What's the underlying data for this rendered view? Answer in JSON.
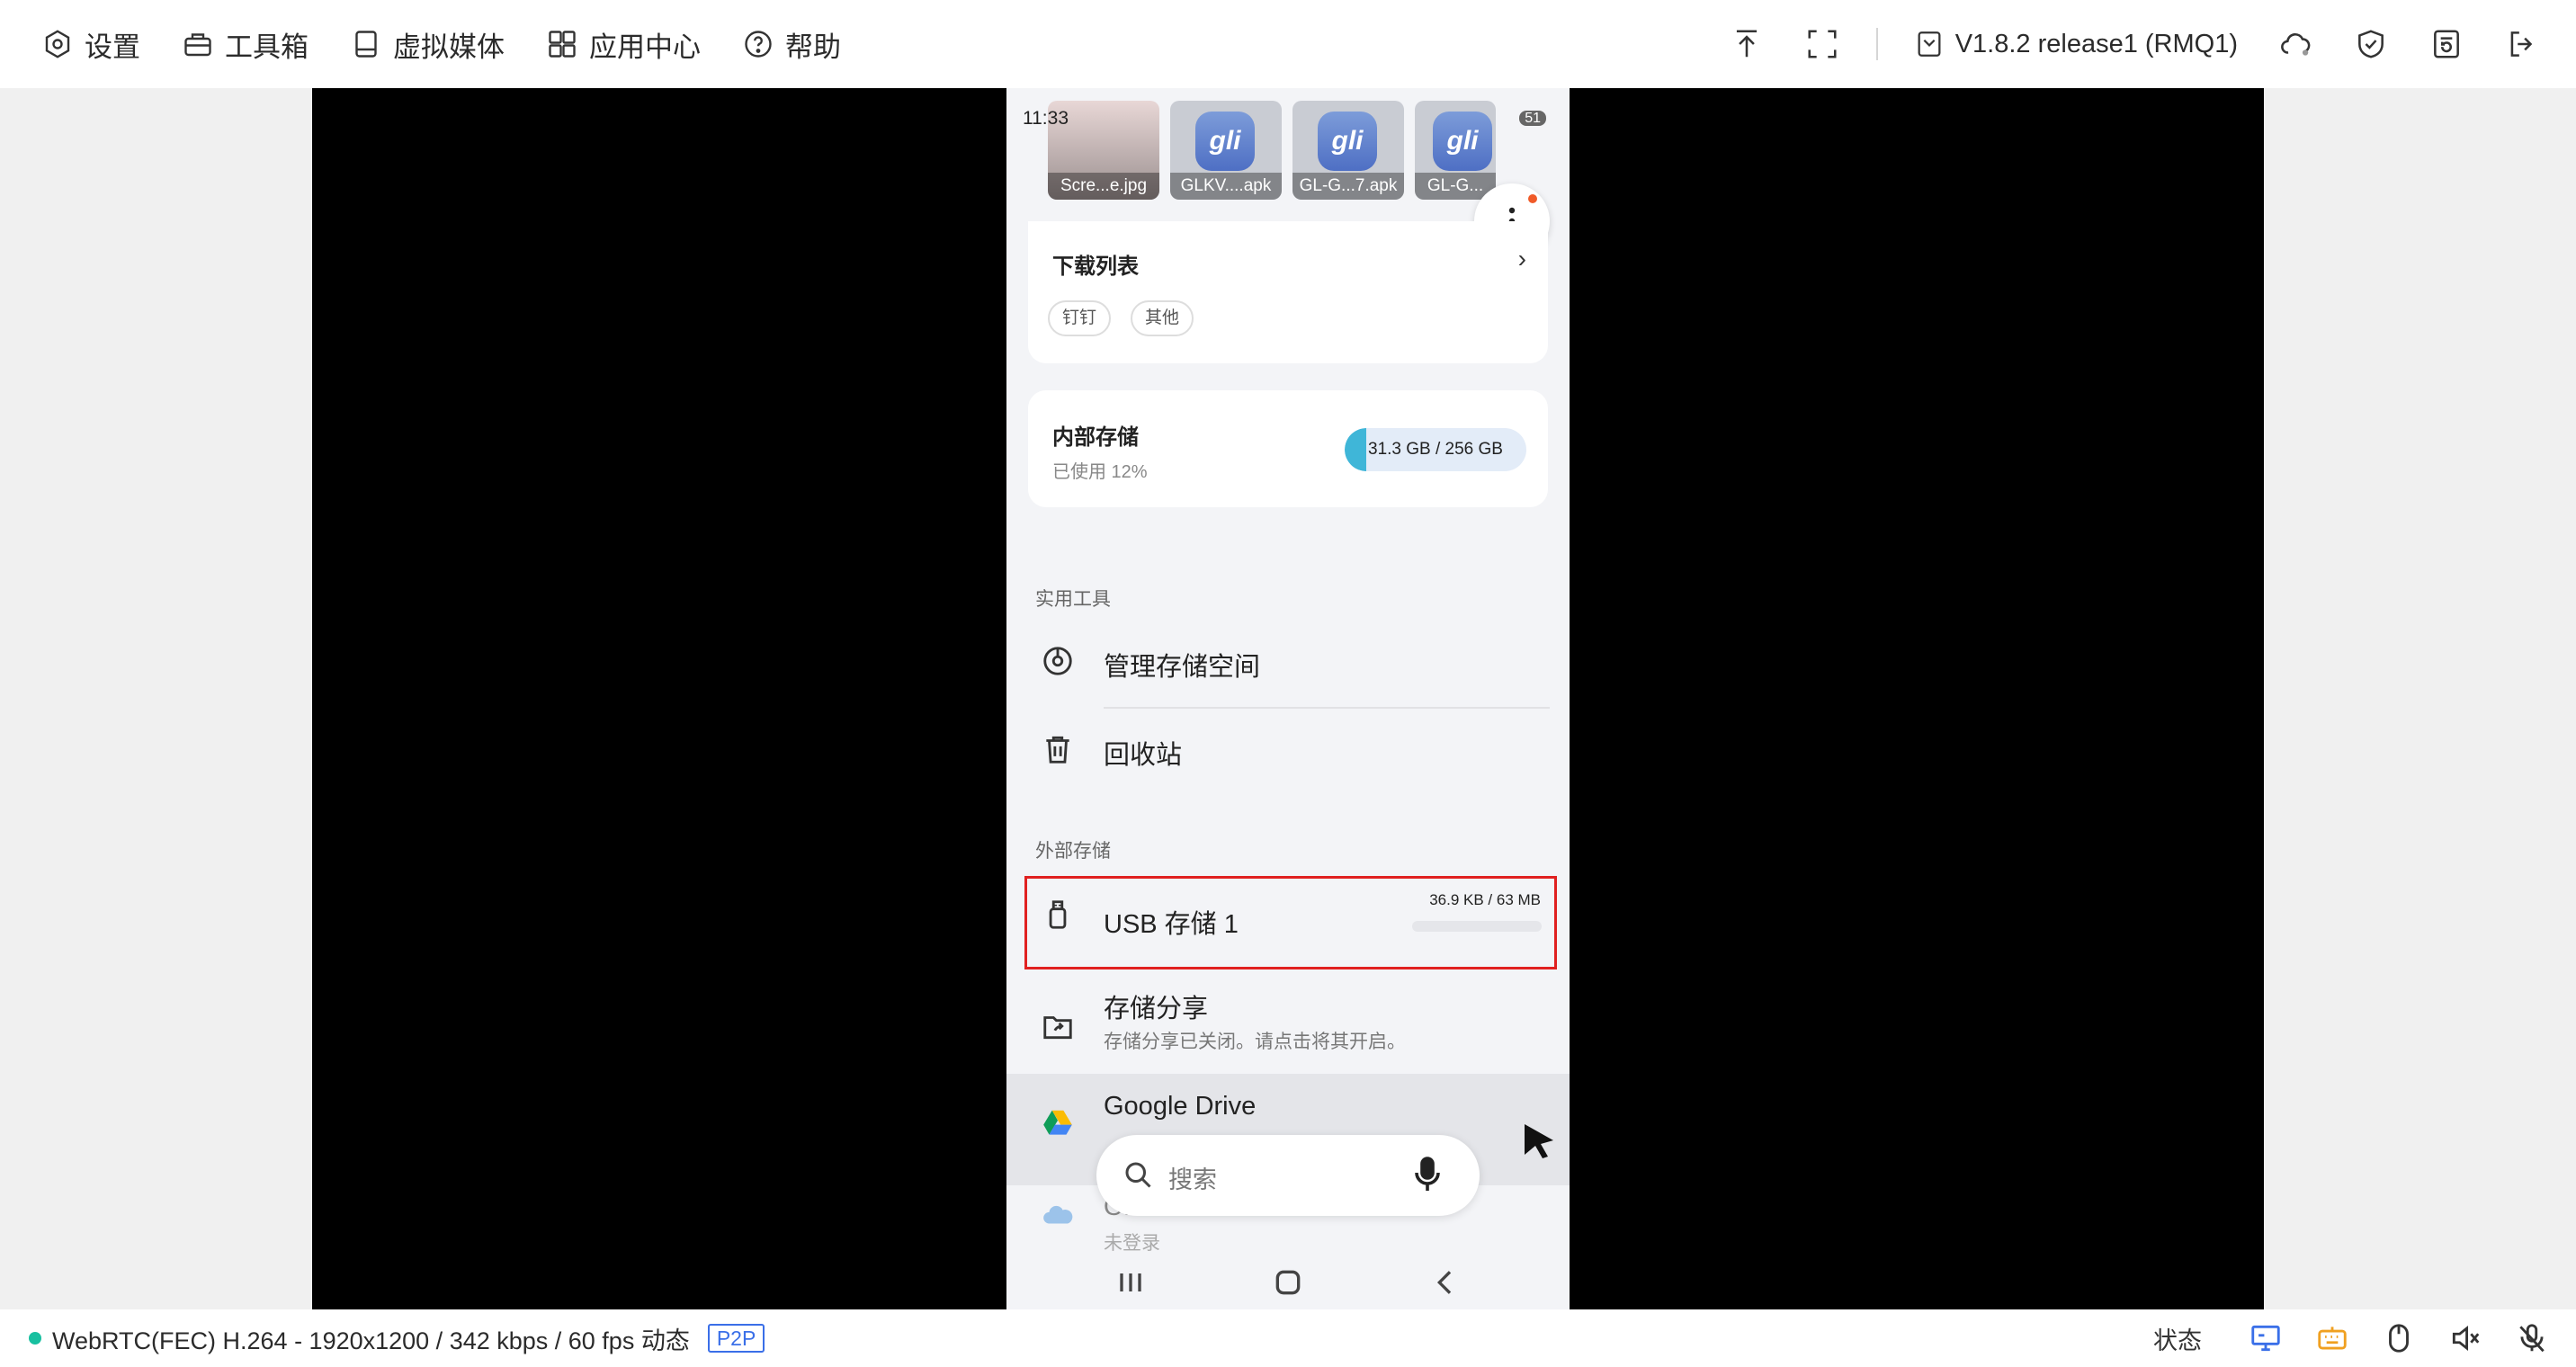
{
  "toolbar": {
    "nav": [
      {
        "label": "设置",
        "icon": "settings-icon"
      },
      {
        "label": "工具箱",
        "icon": "toolbox-icon"
      },
      {
        "label": "虚拟媒体",
        "icon": "virtual-media-icon"
      },
      {
        "label": "应用中心",
        "icon": "app-center-icon"
      },
      {
        "label": "帮助",
        "icon": "help-icon"
      }
    ],
    "version": "V1.8.2 release1 (RMQ1)"
  },
  "phone": {
    "status_time": "11:33",
    "status_right": "51",
    "thumbnails": [
      {
        "caption": "Scre...e.jpg",
        "logo": ""
      },
      {
        "caption": "GLKV....apk",
        "logo": "gli"
      },
      {
        "caption": "GL-G...7.apk",
        "logo": "gli"
      },
      {
        "caption": "GL-G...",
        "logo": "gli"
      }
    ],
    "download_list": {
      "title": "下载列表",
      "chips": [
        "钉钉",
        "其他"
      ]
    },
    "internal_storage": {
      "title": "内部存储",
      "used_text": "已使用 12%",
      "used_fraction": 0.12,
      "capacity": "31.3 GB  / 256 GB"
    },
    "tools_section": "实用工具",
    "tools": [
      {
        "label": "管理存储空间",
        "icon": "storage-manage-icon"
      },
      {
        "label": "回收站",
        "icon": "trash-icon"
      }
    ],
    "external_section": "外部存储",
    "usb": {
      "label": "USB 存储 1",
      "size": "36.9 KB / 63 MB",
      "used_fraction": 0.0006
    },
    "storage_share": {
      "label": "存储分享",
      "sub": "存储分享已关闭。请点击将其开启。"
    },
    "google_drive": {
      "label": "Google Drive"
    },
    "onedrive": {
      "label": "OneDrive",
      "sub": "未登录"
    },
    "search_placeholder": "搜索"
  },
  "statusbar": {
    "stream_info": "WebRTC(FEC) H.264 - 1920x1200 /  342 kbps / 60 fps 动态",
    "badge": "P2P",
    "status_label": "状态",
    "accent": "#3a6fe8",
    "indicator_color": "#18c0a0"
  }
}
